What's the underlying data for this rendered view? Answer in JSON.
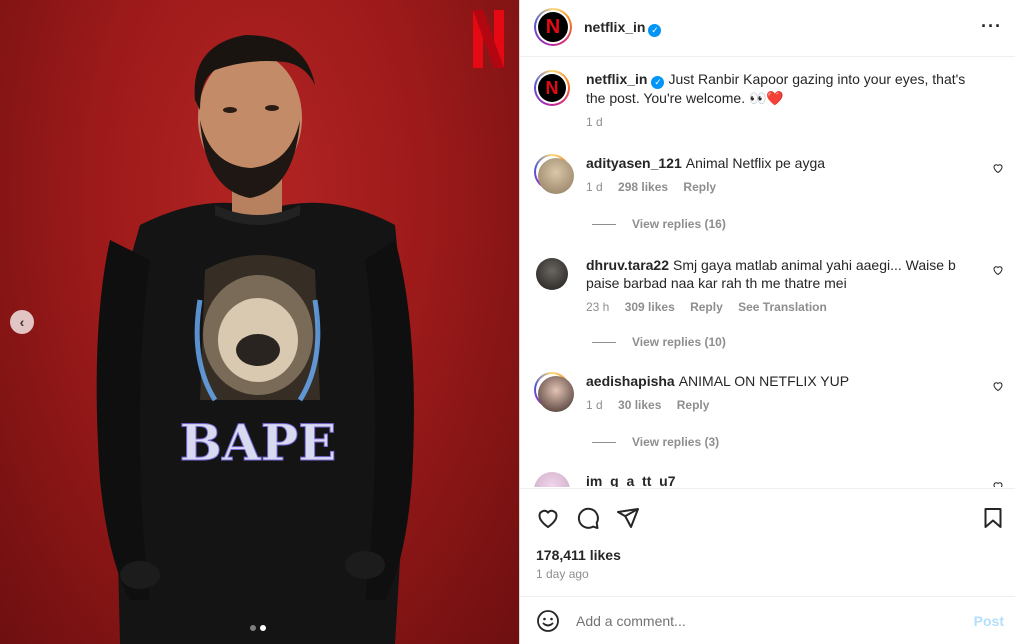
{
  "post": {
    "account": "netflix_in",
    "caption": "Just Ranbir Kapoor gazing into your eyes, that's the post. You're welcome. 👀❤️",
    "caption_time": "1 d",
    "likes": "178,411 likes",
    "posted": "1 day ago",
    "image_carousel": {
      "count": 2,
      "active_index": 1
    },
    "logo_letter": "N"
  },
  "comments": [
    {
      "user": "adityasen_121",
      "text": "Animal Netflix pe ayga",
      "time": "1 d",
      "likes": "298 likes",
      "reply": "Reply",
      "view_replies": "View replies (16)"
    },
    {
      "user": "dhruv.tara22",
      "text": "Smj gaya matlab animal yahi aaegi... Waise b paise barbad naa kar rah th me thatre mei",
      "time": "23 h",
      "likes": "309 likes",
      "reply": "Reply",
      "translate": "See Translation",
      "view_replies": "View replies (10)"
    },
    {
      "user": "aedishapisha",
      "text": "ANIMAL ON NETFLIX YUP",
      "time": "1 d",
      "likes": "30 likes",
      "reply": "Reply",
      "view_replies": "View replies (3)"
    },
    {
      "user": "im_g_a_tt_u7"
    }
  ],
  "composer": {
    "placeholder": "Add a comment...",
    "post_label": "Post"
  },
  "icons": {
    "more": "more-icon",
    "like": "heart-icon",
    "comment": "comment-icon",
    "share": "share-icon",
    "save": "bookmark-icon",
    "emoji": "emoji-icon",
    "prev": "chevron-left-icon"
  },
  "colors": {
    "brand_red": "#e50914",
    "verified_blue": "#0095f6",
    "post_disabled": "#b2dffc",
    "background_red": "#9d1a1a"
  }
}
